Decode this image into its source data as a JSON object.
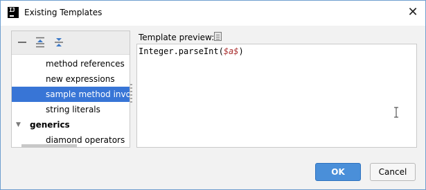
{
  "window": {
    "title": "Existing Templates",
    "close_glyph": "✕",
    "app_icon_text": "IJ"
  },
  "toolbar": {
    "collapse_icon": "minus-icon",
    "expand_all_icon": "expand-all-icon",
    "collapse_all_icon": "collapse-all-icon"
  },
  "tree": {
    "items": [
      {
        "label": "method references",
        "type": "leaf",
        "selected": false
      },
      {
        "label": "new expressions",
        "type": "leaf",
        "selected": false
      },
      {
        "label": "sample method invoc",
        "type": "leaf",
        "selected": true
      },
      {
        "label": "string literals",
        "type": "leaf",
        "selected": false
      },
      {
        "label": "generics",
        "type": "group",
        "expanded": true,
        "selected": false
      },
      {
        "label": "diamond operators",
        "type": "leaf",
        "selected": false
      }
    ]
  },
  "preview": {
    "label": "Template preview:",
    "code_prefix": "Integer.parseInt(",
    "code_var": "$a$",
    "code_suffix": ")"
  },
  "buttons": {
    "ok": "OK",
    "cancel": "Cancel"
  },
  "colors": {
    "selection": "#3875d6",
    "ok_button": "#4a8fd9",
    "template_variable": "#a82d2d"
  }
}
